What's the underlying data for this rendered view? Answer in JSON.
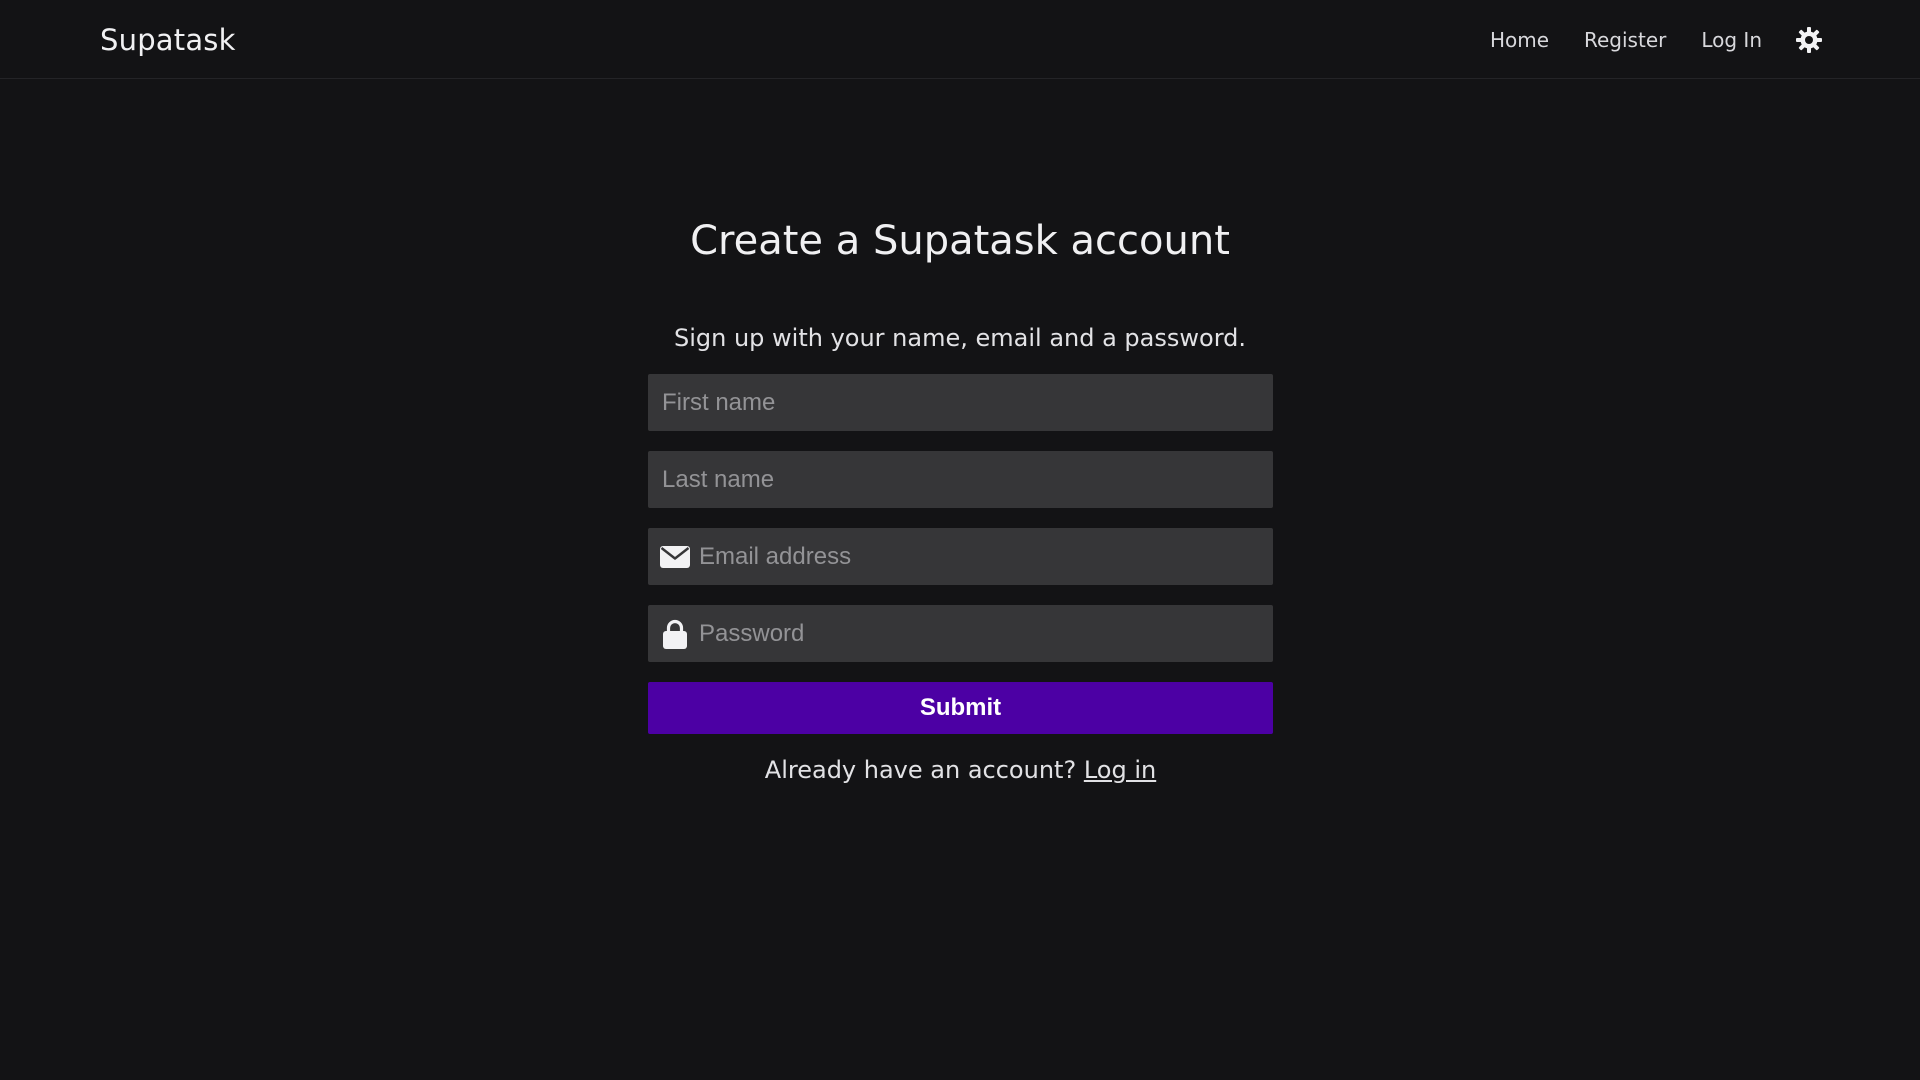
{
  "app": {
    "brand": "Supatask"
  },
  "nav": {
    "items": [
      {
        "label": "Home"
      },
      {
        "label": "Register"
      },
      {
        "label": "Log In"
      }
    ],
    "theme_toggle_icon": "sun-gear-icon"
  },
  "page": {
    "title": "Create a Supatask account",
    "subtitle": "Sign up with your name, email and a password."
  },
  "form": {
    "first_name": {
      "placeholder": "First name",
      "value": ""
    },
    "last_name": {
      "placeholder": "Last name",
      "value": ""
    },
    "email": {
      "placeholder": "Email address",
      "value": "",
      "icon": "envelope-icon"
    },
    "password": {
      "placeholder": "Password",
      "value": "",
      "icon": "lock-icon"
    },
    "submit_label": "Submit"
  },
  "footer": {
    "prompt": "Already have an account?",
    "login_link": "Log in"
  },
  "colors": {
    "background": "#131315",
    "input_background": "#363638",
    "accent": "#4c00a4",
    "text": "#e8e8ea",
    "placeholder": "#939396"
  }
}
